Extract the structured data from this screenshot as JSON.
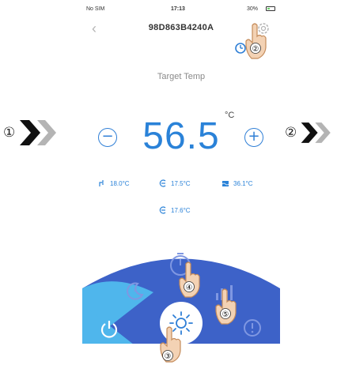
{
  "annotations": {
    "left_number": "①",
    "right_number": "②",
    "hand_numbers": [
      "②",
      "③",
      "④",
      "⑤"
    ]
  },
  "statusbar": {
    "carrier": "No SIM",
    "time": "17:13",
    "battery": "30%"
  },
  "header": {
    "device_id": "98D863B4240A"
  },
  "main": {
    "target_label": "Target Temp",
    "unit": "°C",
    "temperature": "56.5",
    "minus_symbol": "−",
    "plus_symbol": "+"
  },
  "readings": [
    {
      "icon": "water-inlet-icon",
      "value": "18.0°C"
    },
    {
      "icon": "sensor-icon",
      "value": "17.5°C"
    },
    {
      "icon": "tank-icon",
      "value": "36.1°C"
    },
    {
      "icon": "sensor-return-icon",
      "value": "17.6°C"
    }
  ],
  "colors": {
    "accent": "#2a82d8",
    "panel_dark": "#3d62c8",
    "panel_light": "#4fb6ec",
    "background": "#ffffff"
  }
}
